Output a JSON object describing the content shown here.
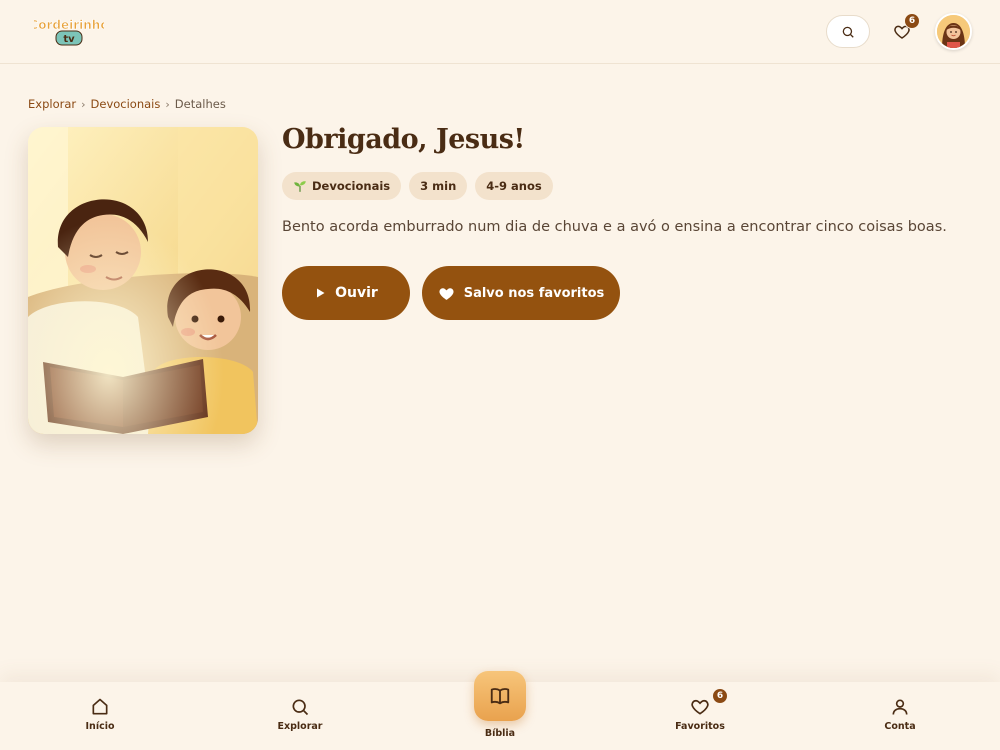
{
  "header": {
    "logo_top": "Cordeirinho",
    "logo_bottom": "tv",
    "favorites_count": "6"
  },
  "breadcrumb": {
    "items": [
      "Explorar",
      "Devocionais"
    ],
    "current": "Detalhes",
    "separator": "›"
  },
  "story": {
    "title": "Obrigado, Jesus!",
    "category": "Devocionais",
    "duration": "3 min",
    "age_range": "4-9 anos",
    "description": "Bento acorda emburrado num dia de chuva e a avó o ensina a encontrar cinco coisas boas.",
    "listen_label": "Ouvir",
    "saved_label": "Salvo nos favoritos"
  },
  "bottom_nav": {
    "items": [
      {
        "label": "Início",
        "icon": "home-icon"
      },
      {
        "label": "Explorar",
        "icon": "search-icon"
      },
      {
        "label": "Bíblia",
        "icon": "book-icon"
      },
      {
        "label": "Favoritos",
        "icon": "heart-icon"
      },
      {
        "label": "Conta",
        "icon": "user-icon"
      }
    ],
    "favorites_count": "6"
  },
  "colors": {
    "background": "#fcf4e9",
    "primary": "#94520f",
    "text": "#4a2c14",
    "tag_bg": "#f3e2cc"
  }
}
